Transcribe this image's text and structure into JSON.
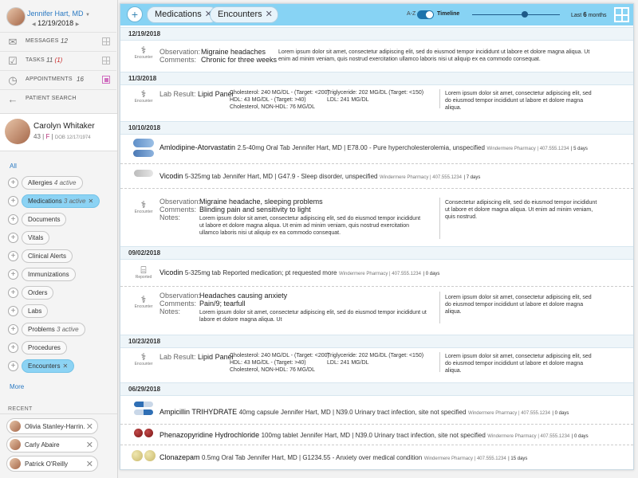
{
  "user": {
    "name": "Jennifer Hart, MD",
    "date": "12/19/2018"
  },
  "nav": [
    {
      "label": "MESSAGES",
      "count": "12"
    },
    {
      "label": "TASKS",
      "count": "11",
      "count_red": "(1)"
    },
    {
      "label": "APPOINTMENTS",
      "count": "16"
    },
    {
      "label": "PATIENT SEARCH"
    }
  ],
  "patient": {
    "name": "Carolyn Whitaker",
    "age": "43",
    "sex": "F",
    "dob": "DOB 12/17/1974"
  },
  "filters": {
    "all_label": "All",
    "more_label": "More",
    "items": [
      {
        "label": "Allergies",
        "count": "4 active"
      },
      {
        "label": "Medications",
        "count": "3 active"
      },
      {
        "label": "Documents"
      },
      {
        "label": "Vitals"
      },
      {
        "label": "Clinical Alerts"
      },
      {
        "label": "Immunizations"
      },
      {
        "label": "Orders"
      },
      {
        "label": "Labs"
      },
      {
        "label": "Problems",
        "count": "3 active"
      },
      {
        "label": "Procedures"
      },
      {
        "label": "Encounters"
      }
    ]
  },
  "recent": {
    "label": "RECENT",
    "items": [
      "Olivia Stanley-Harrin...",
      "Carly Abaire",
      "Patrick O'Reilly"
    ]
  },
  "toolbar": {
    "tags": [
      "Medications",
      "Encounters"
    ],
    "az": "A-Z",
    "timeline": "Timeline",
    "range_prefix": "Last",
    "range_num": "6",
    "range_unit": "months"
  },
  "common": {
    "observation": "Observation:",
    "comments": "Comments:",
    "notes": "Notes:",
    "lab_result": "Lab Result:",
    "encounter": "Encounter",
    "reported": "Reported",
    "lorem_long": "Lorem ipsum dolor sit amet, consectetur adipiscing elit, sed do eiusmod tempor incididunt ut labore et dolore magna aliqua. Ut enim ad minim veniam, quis nostrud exercitation ullamco laboris nisi ut aliquip ex ea commodo consequat.",
    "lorem_med": "Consectetur adipiscing elit, sed do eiusmod tempor incididunt ut labore et dolore magna aliqua. Ut enim ad minim veniam, quis nostrud.",
    "lorem_short": "Lorem ipsum dolor sit amet, consectetur adipiscing elit, sed do eiusmod tempor incididunt ut labore et dolore magna aliqua.",
    "lorem_notes": "Lorem ipsum dolor sit amet, consectetur adipiscing elit, sed do eiusmod tempor incididunt ut labore et dolore magna aliqua. Ut enim ad minim veniam, quis nostrud exercitation ullamco laboris nisi ut aliquip ex ea commodo consequat.",
    "lorem_notes2": "Lorem ipsum dolor sit amet, consectetur adipiscing elit, sed do eiusmod tempor incididunt ut labore et dolore magna aliqua. Ut",
    "lorem_short_right": "Lorem ipsum dolor sit amet, consectetur adipiscing elit, sed do eiusmod tempor incididunt ut labore et dolore magna aliqua."
  },
  "lab": {
    "name": "Lipid Panel",
    "chol": "Cholesterol: 240 MG/DL - (Target: <200)",
    "hdl": "HDL: 43 MG/DL - (Target: >40)",
    "nonhdl": "Cholesterol, NON-HDL: 76 MG/DL",
    "trig": "Triglyceride: 202 MG/DL (Target: <150)",
    "ldl": "LDL: 241 MG/DL"
  },
  "entries": {
    "d1": {
      "date": "12/19/2018",
      "obs": "Migraine headaches",
      "comments": "Chronic for three weeks"
    },
    "d2": {
      "date": "11/3/2018"
    },
    "d3": {
      "date": "10/10/2018",
      "med1_name": "Amlodipine-Atorvastatin",
      "med1_dose": "2.5-40mg Oral Tab",
      "med1_detail": "Jennifer Hart, MD | E78.00 - Pure hypercholesterolemia, unspecified",
      "pharmacy": "Windermere Pharmacy | 407.555.1234",
      "med1_days": "5 days",
      "med2_name": "Vicodin",
      "med2_dose": "5-325mg tab",
      "med2_detail": "Jennifer Hart, MD | G47.9 - Sleep disorder, unspecified",
      "med2_days": "7 days",
      "obs": "Migraine headache, sleeping problems",
      "comments": "Blinding pain and sensitivity to light"
    },
    "d4": {
      "date": "09/02/2018",
      "med_name": "Vicodin",
      "med_dose": "5-325mg tab",
      "med_detail": "Reported medication; pt requested more",
      "pharmacy": "Windermere Pharmacy | 407.555.1234",
      "days": "0 days",
      "obs": "Headaches causing anxiety",
      "comments": "Pain/9; tearfull"
    },
    "d5": {
      "date": "10/23/2018"
    },
    "d6": {
      "date": "06/29/2018",
      "pharmacy": "Windermere Pharmacy | 407.555.1234",
      "m1_name": "Ampicillin TRIHYDRATE",
      "m1_dose": "40mg capsule",
      "m1_detail": "Jennifer Hart, MD | N39.0 Urinary tract infection, site not specified",
      "m1_days": "0 days",
      "m2_name": "Phenazopyridine Hydrochloride",
      "m2_dose": "100mg tablet",
      "m2_detail": "Jennifer Hart, MD | N39.0 Urinary tract infection, site not specified",
      "m2_days": "0 days",
      "m3_name": "Clonazepam",
      "m3_dose": "0.5mg Oral Tab",
      "m3_detail": "Jennifer Hart, MD | G1234.55 - Anxiety over medical condition",
      "m3_days": "15 days"
    }
  }
}
